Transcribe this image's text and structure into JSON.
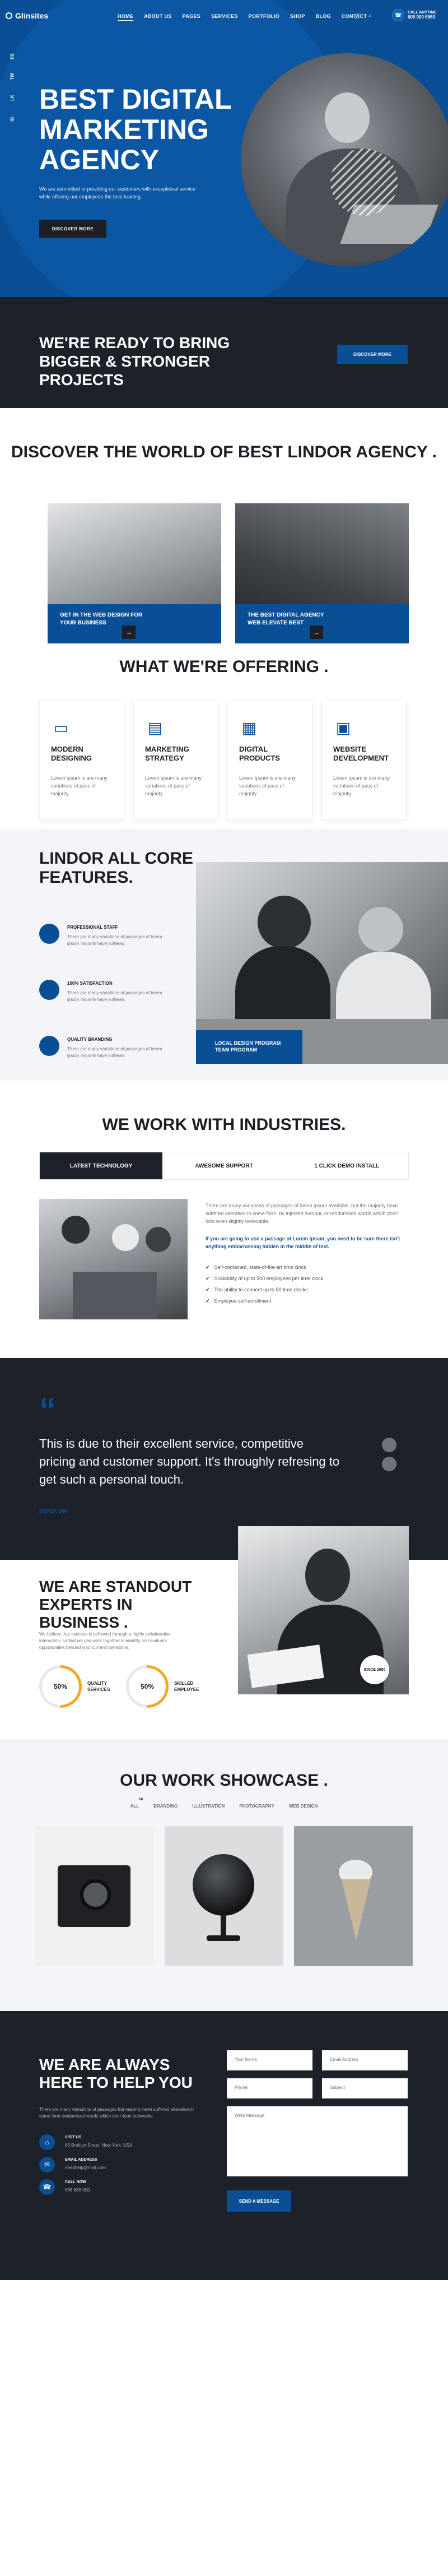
{
  "nav": {
    "logo": "Glinsites",
    "menu": [
      "HOME",
      "ABOUT US",
      "PAGES",
      "SERVICES",
      "PORTFOLIO",
      "SHOP",
      "BLOG",
      "CONTACT"
    ],
    "call_label": "CALL ANYTIME",
    "call_number": "609 000 6660",
    "social": [
      "FB",
      "TW",
      "LK",
      "IG"
    ]
  },
  "hero": {
    "title": "BEST DIGITAL MARKETING AGENCY",
    "lead": "We are committed to providing our customers with exceptional service while offering our employees the best training.",
    "button": "DISCOVER MORE"
  },
  "ready": {
    "title": "WE'RE READY TO BRING BIGGER & STRONGER PROJECTS",
    "button": "DISCOVER MORE"
  },
  "discover": {
    "title": "DISCOVER THE WORLD OF BEST LINDOR AGENCY .",
    "cards": [
      {
        "text": "GET IN THE WEB DESIGN FOR YOUR BUSINESS"
      },
      {
        "text": "THE BEST DIGITAL AGENCY WEB ELEVATE BEST"
      }
    ],
    "arrow": "→"
  },
  "offering": {
    "title": "WHAT WE'RE OFFERING .",
    "items": [
      {
        "icon": "monitor-icon",
        "glyph": "▭",
        "title": "MODERN DESIGNING",
        "text": "Lorem ipsum is are many variations of pass of majority."
      },
      {
        "icon": "strategy-icon",
        "glyph": "▤",
        "title": "MARKETING STRATEGY",
        "text": "Lorem ipsum is are many variations of pass of majority."
      },
      {
        "icon": "products-icon",
        "glyph": "▦",
        "title": "DIGITAL PRODUCTS",
        "text": "Lorem ipsum is are many variations of pass of majority."
      },
      {
        "icon": "code-icon",
        "glyph": "▣",
        "title": "WEBSITE DEVELOPMENT",
        "text": "Lorem ipsum is are many variations of pass of majority."
      }
    ]
  },
  "core": {
    "title": "LINDOR ALL CORE FEATURES.",
    "features": [
      {
        "title": "PROFESSIONAL STAFF",
        "text": "There are many variations of passages of lorem ipsum majority have suffered."
      },
      {
        "title": "100% SATISFACTION",
        "text": "There are many variations of passages of lorem ipsum majority have suffered."
      },
      {
        "title": "QUALITY BRANDING",
        "text": "There are many variations of passages of lorem ipsum majority have suffered."
      }
    ],
    "overlay": "LOCAL DESIGN PROGRAM TEAM PROGRAM"
  },
  "industries": {
    "title": "WE WORK WITH INDUSTRIES.",
    "tabs": [
      "LATEST TECHNOLOGY",
      "AWESOME SUPPORT",
      "1 CLICK DEMO INSTALL"
    ],
    "text1": "There are many variations of passages of lorem ipsum available, but the majority have suffered alteration in some form, by injected humour, or randomised words which don't look even slightly believable.",
    "text2": "If you are going to use a passage of Lorem Ipsum, you need to be sure there isn't anything embarrassing hidden in the middle of text.",
    "list": [
      "Self-contained, state-of-the-art time clock",
      "Scalability of up to 500 employees per time clock",
      "The ability to connect up to 50 time clocks",
      "Employee self-enrollment"
    ],
    "check": "✓"
  },
  "testimonial": {
    "quote_mark": "“",
    "text": "This is due to their excellent service, competitive pricing and customer support. It's throughly refresing to get such a personal touch.",
    "name": "DEREK SIM"
  },
  "standout": {
    "title": "WE ARE STANDOUT EXPERTS IN BUSINESS .",
    "text": "We believe that success is achieved through a highly collaborative interaction, so that we can work together to identify and evaluate opportunities beyond your current operations.",
    "badge": "SINCE 2000",
    "stats": [
      {
        "value": "50%",
        "label": "QUALITY SERVICES",
        "percent": 0.5
      },
      {
        "value": "50%",
        "label": "SKILLED EMPLOYEE",
        "percent": 0.5
      }
    ],
    "ring_color": "#f5a623"
  },
  "showcase": {
    "title": "OUR WORK SHOWCASE .",
    "filters": [
      "ALL",
      "BRANDING",
      "ILLUSTRATION",
      "PHOTOGRAPHY",
      "WEB DESIGN"
    ],
    "all_count": "06",
    "images": [
      "camera-image",
      "globe-image",
      "ice-cream-image"
    ]
  },
  "contact": {
    "title": "WE ARE ALWAYS HERE TO HELP YOU",
    "text": "There are many variations of passages but majority have suffered alteration in some form randomised words which don't look believable.",
    "items": [
      {
        "label": "VISIT US",
        "value": "66 Broklyn Street, New York, USA",
        "glyph": "⌂"
      },
      {
        "label": "EMAIL ADDRESS",
        "value": "needhelp@mail.com",
        "glyph": "✉"
      },
      {
        "label": "CALL NOW",
        "value": "666 888 000",
        "glyph": "☎"
      }
    ],
    "fields": {
      "name": "Your Name",
      "email": "Email Address",
      "phone": "Phone",
      "subject": "Subject",
      "message": "Write Message"
    },
    "send": "SEND A MESSAGE"
  },
  "colors": {
    "primary": "#0a4f96",
    "dark": "#1d212a",
    "accent": "#f5a623"
  }
}
